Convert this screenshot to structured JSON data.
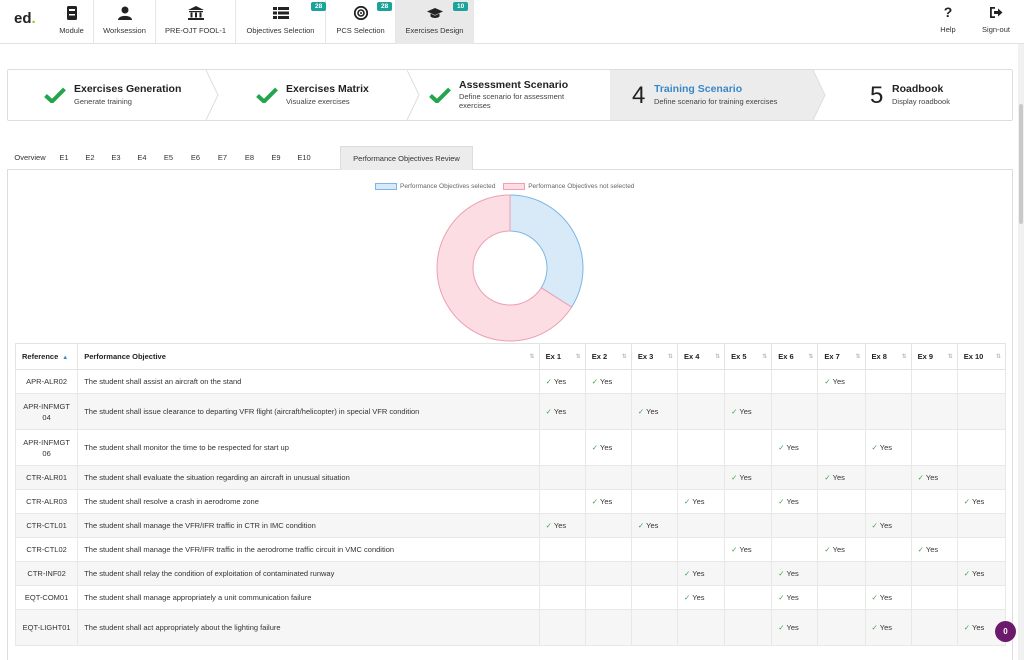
{
  "app": {
    "logo": "ed",
    "logo_dot": "."
  },
  "nav": {
    "items": [
      {
        "label": "Module",
        "icon": "module-icon"
      },
      {
        "label": "Worksession",
        "icon": "user-icon"
      },
      {
        "label": "PRE-OJT FOOL-1",
        "icon": "institution-icon"
      },
      {
        "label": "Objectives Selection",
        "icon": "list-icon",
        "badge": "28"
      },
      {
        "label": "PCS Selection",
        "icon": "target-icon",
        "badge": "28"
      },
      {
        "label": "Exercises Design",
        "icon": "graduation-cap-icon",
        "badge": "10"
      }
    ],
    "help": "Help",
    "signout": "Sign-out"
  },
  "steps": [
    {
      "title": "Exercises Generation",
      "sub": "Generate training",
      "state": "done"
    },
    {
      "title": "Exercises Matrix",
      "sub": "Visualize exercises",
      "state": "done"
    },
    {
      "title": "Assessment Scenario",
      "sub": "Define scenario for assessment exercises",
      "state": "done"
    },
    {
      "num": "4",
      "title": "Training Scenario",
      "sub": "Define scenario for training exercises",
      "state": "active"
    },
    {
      "num": "5",
      "title": "Roadbook",
      "sub": "Display roadbook",
      "state": "todo"
    }
  ],
  "tabs": [
    "Overview",
    "E1",
    "E2",
    "E3",
    "E4",
    "E5",
    "E6",
    "E7",
    "E8",
    "E9",
    "E10",
    "Performance Objectives Review"
  ],
  "active_tab": "Performance Objectives Review",
  "chart_data": {
    "type": "pie",
    "donut": true,
    "legend": [
      {
        "name": "Performance Objectives selected",
        "color": "#a7cff0"
      },
      {
        "name": "Performance Objectives not selected",
        "color": "#f3a9b8"
      }
    ],
    "slices": [
      {
        "name": "Performance Objectives selected",
        "value": 34,
        "fill": "#d8eaf8",
        "stroke": "#7bb6e6"
      },
      {
        "name": "Performance Objectives not selected",
        "value": 66,
        "fill": "#fbdde3",
        "stroke": "#ee9fb0"
      }
    ]
  },
  "table": {
    "headers": [
      "Reference",
      "Performance Objective",
      "Ex 1",
      "Ex 2",
      "Ex 3",
      "Ex 4",
      "Ex 5",
      "Ex 6",
      "Ex 7",
      "Ex 8",
      "Ex 9",
      "Ex 10"
    ],
    "yes_label": "Yes",
    "rows": [
      {
        "ref": "APR-ALR02",
        "objective": "The student shall assist an aircraft on the stand",
        "ex": [
          1,
          1,
          0,
          0,
          0,
          0,
          1,
          0,
          0,
          0
        ]
      },
      {
        "ref": "APR-INFMGT04",
        "objective": "The student shall issue clearance to departing VFR flight (aircraft/helicopter) in special VFR condition",
        "ex": [
          1,
          0,
          1,
          0,
          1,
          0,
          0,
          0,
          0,
          0
        ]
      },
      {
        "ref": "APR-INFMGT06",
        "objective": "The student shall monitor the time to be respected for start up",
        "ex": [
          0,
          1,
          0,
          0,
          0,
          1,
          0,
          1,
          0,
          0
        ]
      },
      {
        "ref": "CTR-ALR01",
        "objective": "The student shall evaluate the situation regarding an aircraft in unusual situation",
        "ex": [
          0,
          0,
          0,
          0,
          1,
          0,
          1,
          0,
          1,
          0
        ]
      },
      {
        "ref": "CTR-ALR03",
        "objective": "The student shall resolve a crash in aerodrome zone",
        "ex": [
          0,
          1,
          0,
          1,
          0,
          1,
          0,
          0,
          0,
          1
        ]
      },
      {
        "ref": "CTR-CTL01",
        "objective": "The student shall manage the VFR/IFR traffic in CTR in IMC condition",
        "ex": [
          1,
          0,
          1,
          0,
          0,
          0,
          0,
          1,
          0,
          0
        ]
      },
      {
        "ref": "CTR-CTL02",
        "objective": "The student shall manage the VFR/IFR traffic in the aerodrome traffic circuit in VMC condition",
        "ex": [
          0,
          0,
          0,
          0,
          1,
          0,
          1,
          0,
          1,
          0
        ]
      },
      {
        "ref": "CTR-INF02",
        "objective": "The student shall relay the condition of exploitation of contaminated runway",
        "ex": [
          0,
          0,
          0,
          1,
          0,
          1,
          0,
          0,
          0,
          1
        ]
      },
      {
        "ref": "EQT-COM01",
        "objective": "The student shall manage appropriately a unit communication failure",
        "ex": [
          0,
          0,
          0,
          1,
          0,
          1,
          0,
          1,
          0,
          0
        ]
      },
      {
        "ref": "EQT-LIGHT01",
        "objective": "The student shall act appropriately about the lighting failure",
        "ex": [
          0,
          0,
          0,
          0,
          0,
          1,
          0,
          1,
          0,
          1
        ]
      }
    ]
  },
  "notification_count": "0"
}
